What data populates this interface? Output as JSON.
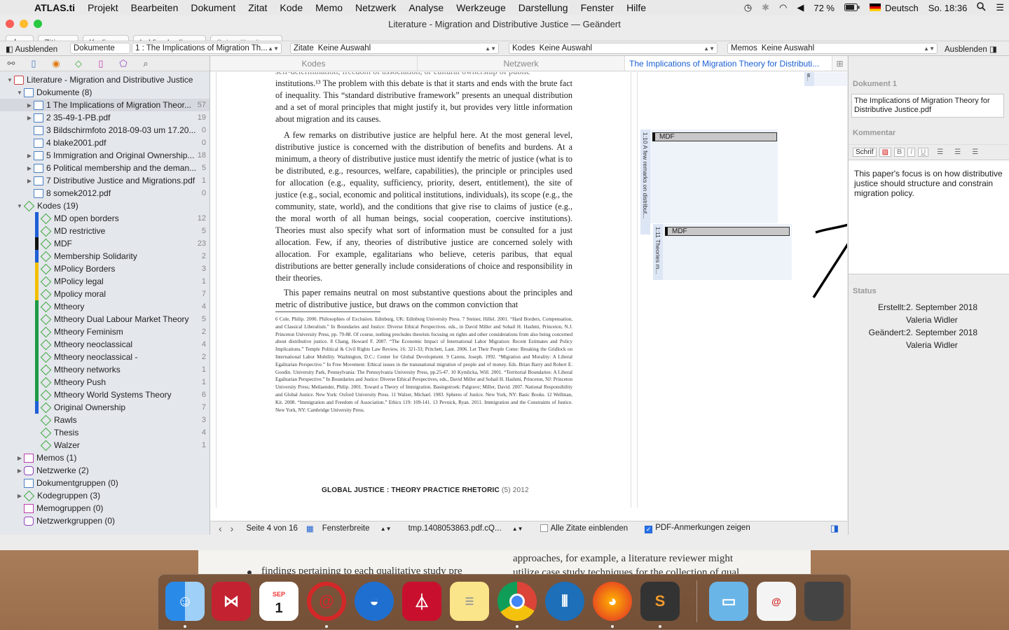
{
  "menubar": {
    "app": "ATLAS.ti",
    "items": [
      "Projekt",
      "Bearbeiten",
      "Dokument",
      "Zitat",
      "Kode",
      "Memo",
      "Netzwerk",
      "Analyse",
      "Werkzeuge",
      "Darstellung",
      "Fenster",
      "Hilfe"
    ],
    "battery": "72 %",
    "language": "Deutsch",
    "clock": "So. 18:36"
  },
  "window": {
    "title": "Literature - Migration and Distributive Justice — Geändert"
  },
  "toolbar": {
    "add": "+",
    "cite": "Zitieren",
    "code": "Kodieren",
    "invivo": "In Vivo kodieren",
    "quick": "Schnellkodieren"
  },
  "navbar": {
    "hide_left": "Ausblenden",
    "documents": "Dokumente",
    "doc_select": "1 : The Implications of Migration Th...",
    "quotes_label": "Zitate",
    "quotes_value": "Keine Auswahl",
    "codes_label": "Kodes",
    "codes_value": "Keine Auswahl",
    "memos_label": "Memos",
    "memos_value": "Keine Auswahl",
    "hide_right": "Ausblenden"
  },
  "tree": {
    "project": "Literature - Migration and Distributive Justice",
    "documents_header": "Dokumente (8)",
    "documents": [
      {
        "label": "1 The Implications of Migration Theor...",
        "count": "57"
      },
      {
        "label": "2 35-49-1-PB.pdf",
        "count": "19"
      },
      {
        "label": "3 Bildschirmfoto 2018-09-03 um 17.20...",
        "count": "0"
      },
      {
        "label": "4 blake2001.pdf",
        "count": "0"
      },
      {
        "label": "5 Immigration and Original Ownership...",
        "count": "18"
      },
      {
        "label": "6 Political membership and the deman...",
        "count": "5"
      },
      {
        "label": "7 Distributive Justice and Migrations.pdf",
        "count": "1"
      },
      {
        "label": "8 somek2012.pdf",
        "count": "0"
      }
    ],
    "codes_header": "Kodes (19)",
    "codes": [
      {
        "label": "MD open borders",
        "count": "12",
        "color": "#1f5fd6"
      },
      {
        "label": "MD restrictive",
        "count": "5",
        "color": "#1f5fd6"
      },
      {
        "label": "MDF",
        "count": "23",
        "color": "#111111"
      },
      {
        "label": "Membership Solidarity",
        "count": "2",
        "color": "#1f5fd6"
      },
      {
        "label": "MPolicy Borders",
        "count": "3",
        "color": "#f2c000"
      },
      {
        "label": "MPolicy legal",
        "count": "1",
        "color": "#f2c000"
      },
      {
        "label": "Mpolicy moral",
        "count": "7",
        "color": "#f2c000"
      },
      {
        "label": "Mtheory",
        "count": "4",
        "color": "#1e9a46"
      },
      {
        "label": "Mtheory Dual Labour Market Theory",
        "count": "5",
        "color": "#1e9a46"
      },
      {
        "label": "Mtheory Feminism",
        "count": "2",
        "color": "#1e9a46"
      },
      {
        "label": "Mtheory neoclassical",
        "count": "4",
        "color": "#1e9a46"
      },
      {
        "label": "Mtheory neoclassical -",
        "count": "2",
        "color": "#1e9a46"
      },
      {
        "label": "Mtheory networks",
        "count": "1",
        "color": "#1e9a46"
      },
      {
        "label": "Mtheory Push",
        "count": "1",
        "color": "#1e9a46"
      },
      {
        "label": "Mtheory World Systems Theory",
        "count": "6",
        "color": "#1e9a46"
      },
      {
        "label": "Original Ownership",
        "count": "7",
        "color": "#1f5fd6"
      },
      {
        "label": "Rawls",
        "count": "3",
        "color": ""
      },
      {
        "label": "Thesis",
        "count": "4",
        "color": ""
      },
      {
        "label": "Walzer",
        "count": "1",
        "color": ""
      }
    ],
    "others": [
      "Memos (1)",
      "Netzwerke (2)",
      "Dokumentgruppen (0)",
      "Kodegruppen (3)",
      "Memogruppen (0)",
      "Netzwerkgruppen (0)"
    ]
  },
  "tabs": {
    "codes": "Kodes",
    "network": "Netzwerk",
    "document": "The Implications of Migration Theory for Distributi..."
  },
  "document": {
    "p0": "institutions.¹³ The problem with this debate is that it starts and ends with the brute fact of inequality. This “standard distributive framework” presents an unequal distribution and a set of moral principles that might justify it, but provides very little information about migration and its causes.",
    "p1": "A few remarks on distributive justice are helpful here. At the most general level, distributive justice is concerned with the distribution of benefits and burdens. At a minimum, a theory of distributive justice must identify the metric of justice (what is to be distributed, e.g., resources, welfare, capabilities), the principle or principles used for allocation (e.g., equality, sufficiency, priority, desert, entitlement), the site of justice (e.g., social, economic and political institutions, individuals), its scope (e.g., the community, state, world), and the conditions that give rise to claims of justice (e.g., the moral worth of all human beings, social cooperation, coercive institutions). Theories must also specify what sort of information must be consulted for a just allocation. Few, if any, theories of distributive justice are concerned solely with allocation. For example, egalitarians who believe, ceteris paribus, that equal distributions are better generally include considerations of choice and responsibility in their theories.",
    "p2": "This paper remains neutral on most substantive questions about the principles and metric of distributive justice, but draws on the common conviction that",
    "footnotes": "6 Cole, Philip. 2000. Philosophies of Exclusion. Edinburg, UK: Edinburg University Press. 7 Steiner, Hillel. 2001. “Hard Borders, Compensation, and Classical Liberalism.” In Boundaries and Justice: Diverse Ethical Perspectives. eds., in David Miller and Sohail H. Hashmi, Princeton, N.J. Princeton University Press, pp. 79-88. Of course, nothing precludes theorists focusing on rights and other considerations from also being concerned about distributive justice. 8 Chang, Howard F. 2007. “The Economic Impact of International Labor Migration: Recent Estimates and Policy Implications.” Temple Political & Civil Rights Law Review, 16: 321-33; Pritchett, Lant. 2006. Let Their People Come: Breaking the Gridlock on International Labor Mobility. Washington, D.C.: Center for Global Development. 9 Carens, Joseph. 1992. “Migration and Morality: A Liberal Egalitarian Perspective.” In Free Movement: Ethical issues in the transnational migration of people and of money. Eds. Brian Barry and Robert E. Goodin. University Park, Pennsylvania: The Pennsylvania University Press, pp.25-47. 10 Kymlicka, Will. 2001. “Territorial Boundaries: A Liberal Egalitarian Perspective.” In Boundaries and Justice: Diverse Ethical Perspectives, eds., David Miller and Sohail H. Hashmi, Princeton, NJ: Princeton University Press; Meilaender, Philip. 2001. Toward a Theory of Immigration. Basingstroek: Palgrave; Miller, David. 2007. National Responsibility and Global Justice. New York: Oxford University Press. 11 Walzer, Michael. 1983. Spheres of Justice. New York, NY: Basic Books. 12 Wellman, Kit. 2008. “Immigration and Freedom of Association.” Ethics 119: 109-141. 13 Pevnick, Ryan. 2011. Immigration and the Constraints of Justice. New York, NY: Cambridge University Press.",
    "footer": "GLOBAL JUSTICE : THEORY PRACTICE RHETORIC",
    "footer_issue": "(5) 2012",
    "top_partial": "self-determination, freedom of association, or cultural ownership of public"
  },
  "margin": {
    "q1_label": "1:10 A few remarks on distribut...",
    "q1_code": "MDF",
    "q2_label": "1:11 Theories m...",
    "q2_code": "MDF",
    "q0_label": "w..."
  },
  "statusbar": {
    "page": "Seite 4 von 16",
    "width": "Fensterbreite",
    "file": "tmp.1408053863.pdf.cQ...",
    "show_all": "Alle Zitate einblenden",
    "show_pdf": "PDF-Anmerkungen zeigen"
  },
  "inspector": {
    "doc_header": "Dokument 1",
    "doc_name": "The Implications of Migration Theory for Distributive Justice.pdf",
    "comment_header": "Kommentar",
    "font_btn": "Schrif",
    "comment": "This paper's focus is on how distributive justice should structure and constrain migration policy.",
    "status_header": "Status",
    "created_label": "Erstellt:",
    "created_date": "2. September 2018",
    "created_by": "Valeria Widler",
    "changed_label": "Geändert:",
    "changed_date": "2. September 2018",
    "changed_by": "Valeria Widler"
  },
  "background_doc": {
    "line1": "approaches, for example, a literature reviewer might",
    "line2": "utilize case study techniques for the collection of qual",
    "line3": "findings pertaining to each qualitative study pre"
  },
  "dock": {
    "calendar_month": "SEP",
    "calendar_day": "1"
  }
}
